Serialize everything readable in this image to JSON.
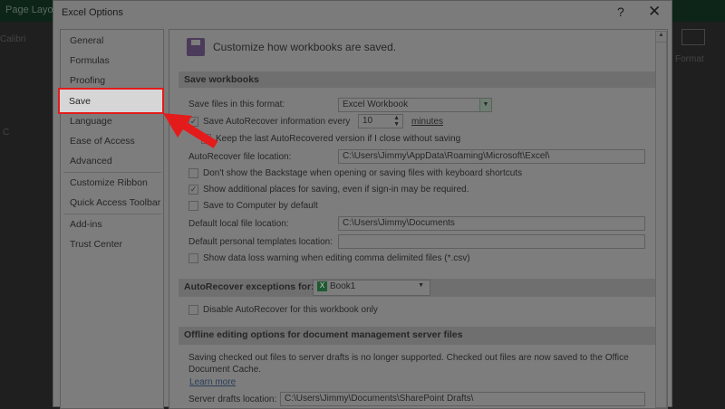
{
  "background": {
    "tab": "Page Layout",
    "font": "Calibri",
    "format": "Format",
    "column": "C"
  },
  "dialog": {
    "title": "Excel Options",
    "help": "?",
    "close": "✕"
  },
  "nav": {
    "items": [
      "General",
      "Formulas",
      "Proofing",
      "Save",
      "Language",
      "Ease of Access",
      "Advanced",
      "Customize Ribbon",
      "Quick Access Toolbar",
      "Add-ins",
      "Trust Center"
    ],
    "selected": "Save"
  },
  "content": {
    "header": "Customize how workbooks are saved.",
    "save_section": "Save workbooks",
    "format_label": "Save files in this format:",
    "format_value": "Excel Workbook",
    "autorecover_label": "Save AutoRecover information every",
    "autorecover_minutes": "10",
    "minutes": "minutes",
    "autorecover_checked": true,
    "keep_last": "Keep the last AutoRecovered version if I close without saving",
    "keep_checked": true,
    "ar_location_label": "AutoRecover file location:",
    "ar_location": "C:\\Users\\Jimmy\\AppData\\Roaming\\Microsoft\\Excel\\",
    "backstage": "Don't show the Backstage when opening or saving files with keyboard shortcuts",
    "backstage_checked": false,
    "additional": "Show additional places for saving, even if sign-in may be required.",
    "additional_checked": true,
    "computer": "Save to Computer by default",
    "computer_checked": false,
    "local_label": "Default local file location:",
    "local_value": "C:\\Users\\Jimmy\\Documents",
    "templates_label": "Default personal templates location:",
    "templates_value": "",
    "csv": "Show data loss warning when editing comma delimited files (*.csv)",
    "csv_checked": false,
    "exceptions_label": "AutoRecover exceptions for:",
    "exceptions_value": "Book1",
    "disable": "Disable AutoRecover for this workbook only",
    "disable_checked": false,
    "offline_section": "Offline editing options for document management server files",
    "offline_text": "Saving checked out files to server drafts is no longer supported. Checked out files are now saved to the Office Document Cache.",
    "learn_more": "Learn more",
    "drafts_label": "Server drafts location:",
    "drafts_value": "C:\\Users\\Jimmy\\Documents\\SharePoint Drafts\\"
  },
  "annotation_color": "#e41b1b"
}
